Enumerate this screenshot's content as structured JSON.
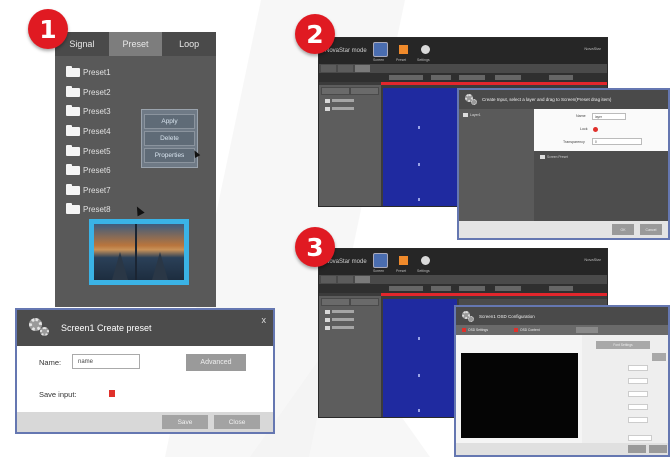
{
  "steps": [
    "1",
    "2",
    "3"
  ],
  "panel1": {
    "tabs": [
      "Signal",
      "Preset",
      "Loop"
    ],
    "active_tab": "Preset",
    "presets": [
      "Preset1",
      "Preset2",
      "Preset3",
      "Preset4",
      "Preset5",
      "Preset6",
      "Preset7",
      "Preset8"
    ],
    "context_menu": [
      "Apply",
      "Delete",
      "Properties"
    ]
  },
  "create_preset_dialog": {
    "title": "Screen1 Create preset",
    "close": "x",
    "name_label": "Name:",
    "name_value": "name",
    "advanced_button": "Advanced",
    "save_input_label": "Save input:",
    "save_button": "Save",
    "close_button": "Close"
  },
  "app": {
    "logo": "NovaStar mode",
    "toolbar": [
      "Screen",
      "Preset",
      "Settings"
    ],
    "title_right": "NovaStar"
  },
  "layer_dialog": {
    "title": "Create Input, select a layer and drag to Screen(Preset drag item)",
    "list_item": "Layer1",
    "name_label": "Name",
    "name_value": "layer",
    "lock_label": "Lock",
    "transparency_label": "Transparency",
    "transparency_value": "0",
    "screen_label": "Screen Preset",
    "ok_button": "OK",
    "cancel_button": "Cancel"
  },
  "config_dialog": {
    "title": "Screen1 OSD Configuration",
    "tabs": [
      "OSD Settings",
      "OSD Content"
    ],
    "settings_button": "Font Settings"
  },
  "colors": {
    "badge": "#e01a22",
    "highlight": "#3ab3e6",
    "dialog_border": "#6577b1",
    "workspace_blue": "#1f2aa0",
    "timeline_red": "#e3262c"
  }
}
